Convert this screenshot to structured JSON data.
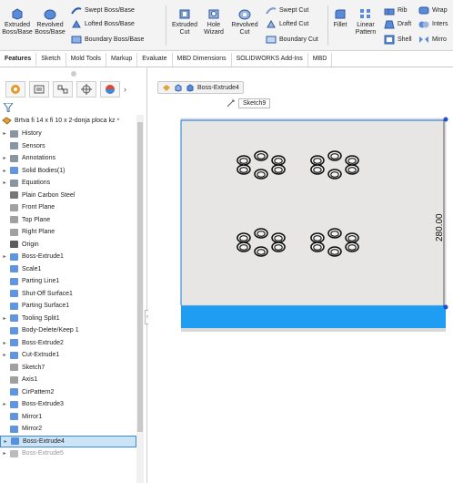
{
  "ribbon": {
    "extruded_boss": "Extruded Boss/Base",
    "revolved_boss": "Revolved Boss/Base",
    "swept_boss": "Swept Boss/Base",
    "lofted_boss": "Lofted Boss/Base",
    "boundary_boss": "Boundary Boss/Base",
    "extruded_cut": "Extruded Cut",
    "hole_wizard": "Hole Wizard",
    "revolved_cut": "Revolved Cut",
    "swept_cut": "Swept Cut",
    "lofted_cut": "Lofted Cut",
    "boundary_cut": "Boundary Cut",
    "fillet": "Fillet",
    "linear_pattern": "Linear Pattern",
    "rib": "Rib",
    "draft": "Draft",
    "shell": "Shell",
    "wrap": "Wrap",
    "intersect": "Inters",
    "mirror": "Mirro"
  },
  "tabs": [
    "Features",
    "Sketch",
    "Mold Tools",
    "Markup",
    "Evaluate",
    "MBD Dimensions",
    "SOLIDWORKS Add-Ins",
    "MBD"
  ],
  "tree": {
    "root": "Brtva fi 14 x fi 10 x 2-donja ploca kz",
    "items": [
      {
        "label": "History",
        "arrow": "▸",
        "icon": "history-icon",
        "color": "#6b7b8c"
      },
      {
        "label": "Sensors",
        "arrow": "",
        "icon": "sensor-icon",
        "color": "#6b7b8c"
      },
      {
        "label": "Annotations",
        "arrow": "▸",
        "icon": "annotation-icon",
        "color": "#6b7b8c"
      },
      {
        "label": "Solid Bodies(1)",
        "arrow": "▸",
        "icon": "solid-body-icon",
        "color": "#3a7bd5"
      },
      {
        "label": "Equations",
        "arrow": "▸",
        "icon": "equation-icon",
        "color": "#6b7b8c"
      },
      {
        "label": "Plain Carbon Steel",
        "arrow": "",
        "icon": "material-icon",
        "color": "#555555"
      },
      {
        "label": "Front Plane",
        "arrow": "",
        "icon": "plane-icon",
        "color": "#8a8a8a"
      },
      {
        "label": "Top Plane",
        "arrow": "",
        "icon": "plane-icon",
        "color": "#8a8a8a"
      },
      {
        "label": "Right Plane",
        "arrow": "",
        "icon": "plane-icon",
        "color": "#8a8a8a"
      },
      {
        "label": "Origin",
        "arrow": "",
        "icon": "origin-icon",
        "color": "#333333"
      },
      {
        "label": "Boss-Extrude1",
        "arrow": "▸",
        "icon": "extrude-icon",
        "color": "#3a7bd5"
      },
      {
        "label": "Scale1",
        "arrow": "",
        "icon": "scale-icon",
        "color": "#3a7bd5"
      },
      {
        "label": "Parting Line1",
        "arrow": "",
        "icon": "parting-line-icon",
        "color": "#3a7bd5"
      },
      {
        "label": "Shut-Off Surface1",
        "arrow": "",
        "icon": "shutoff-surface-icon",
        "color": "#3a7bd5"
      },
      {
        "label": "Parting Surface1",
        "arrow": "",
        "icon": "parting-surface-icon",
        "color": "#3a7bd5"
      },
      {
        "label": "Tooling Split1",
        "arrow": "▸",
        "icon": "tooling-split-icon",
        "color": "#3a7bd5"
      },
      {
        "label": "Body-Delete/Keep 1",
        "arrow": "",
        "icon": "body-delete-icon",
        "color": "#3a7bd5"
      },
      {
        "label": "Boss-Extrude2",
        "arrow": "▸",
        "icon": "extrude-icon",
        "color": "#3a7bd5"
      },
      {
        "label": "Cut-Extrude1",
        "arrow": "▸",
        "icon": "cut-extrude-icon",
        "color": "#3a7bd5"
      },
      {
        "label": "Sketch7",
        "arrow": "",
        "icon": "sketch-icon",
        "color": "#888888"
      },
      {
        "label": "Axis1",
        "arrow": "",
        "icon": "axis-icon",
        "color": "#888888"
      },
      {
        "label": "CirPattern2",
        "arrow": "",
        "icon": "circular-pattern-icon",
        "color": "#3a7bd5"
      },
      {
        "label": "Boss-Extrude3",
        "arrow": "▸",
        "icon": "extrude-icon",
        "color": "#3a7bd5"
      },
      {
        "label": "Mirror1",
        "arrow": "",
        "icon": "mirror-icon",
        "color": "#3a7bd5"
      },
      {
        "label": "Mirror2",
        "arrow": "",
        "icon": "mirror-icon",
        "color": "#3a7bd5"
      },
      {
        "label": "Boss-Extrude4",
        "arrow": "▸",
        "icon": "extrude-icon",
        "color": "#3a7bd5",
        "selected": true
      },
      {
        "label": "Boss-Extrude5",
        "arrow": "▸",
        "icon": "extrude-icon",
        "color": "#aaaaaa",
        "dim": true
      }
    ]
  },
  "canvas": {
    "breadcrumb_label": "Boss-Extrude4",
    "sketch_label": "Sketch9",
    "dimension": "280.00",
    "part_top_color": "#e7e6e4",
    "part_side_color": "#1e9df2",
    "edge_highlight": "#3c8be0"
  }
}
